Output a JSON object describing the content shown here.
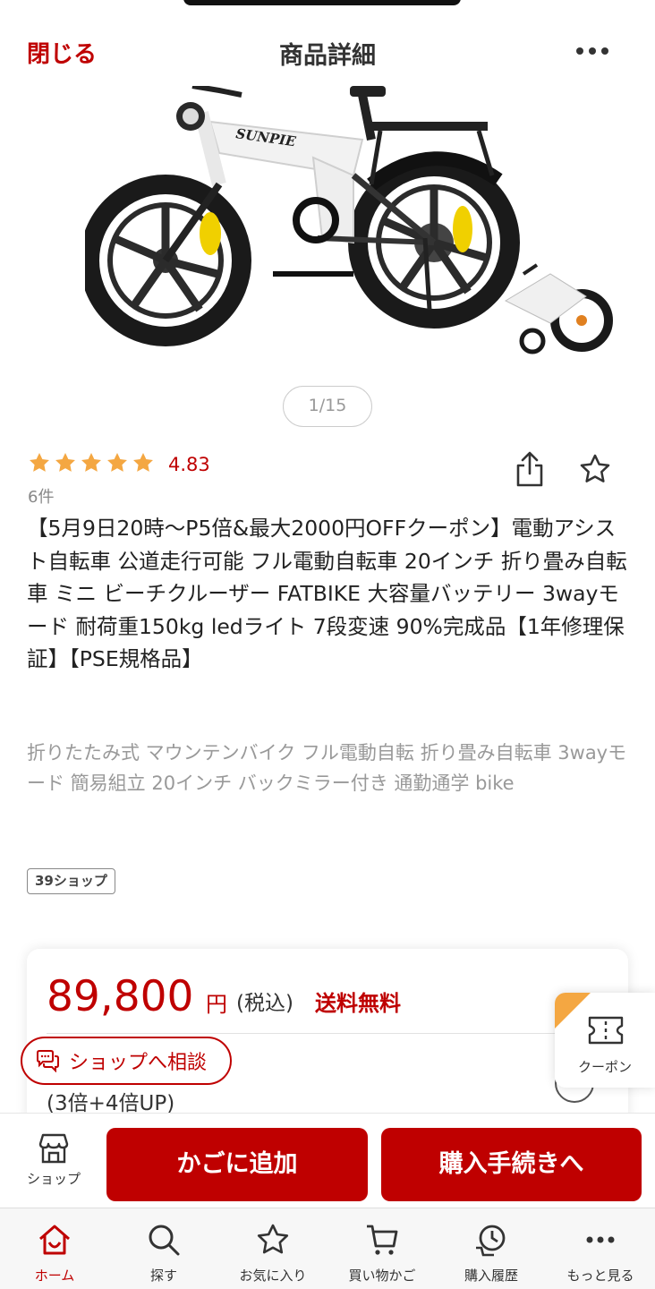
{
  "header": {
    "close_label": "閉じる",
    "title": "商品詳細"
  },
  "gallery": {
    "brand_on_frame": "SUNPIE",
    "page_indicator": "1/15"
  },
  "rating": {
    "stars": 5,
    "value": "4.83",
    "count": "6件"
  },
  "product": {
    "title": "【5月9日20時〜P5倍&最大2000円OFFクーポン】電動アシスト自転車 公道走行可能 フル電動自転車 20インチ 折り畳み自転車 ミニ ビーチクルーザー FATBIKE 大容量バッテリー 3wayモード 耐荷重150kg ledライト 7段変速 90%完成品【1年修理保証】【PSE規格品】",
    "subtitle": "折りたたみ式 マウンテンバイク フル電動自転 折り畳み自転車 3wayモード  簡易組立  20インチ バックミラー付き 通勤通学 bike",
    "shop_tag": "39ショップ"
  },
  "price_card": {
    "price": "89,800",
    "unit": "円",
    "tax": "(税込)",
    "shipping": "送料無料",
    "points": "(3倍+4倍UP)"
  },
  "floating": {
    "consult_label": "ショップへ相談",
    "coupon_label": "クーポン"
  },
  "action_bar": {
    "shop_label": "ショップ",
    "cart_label": "かごに追加",
    "buy_label": "購入手続きへ"
  },
  "bottom_nav": {
    "items": [
      {
        "label": "ホーム",
        "icon": "home-icon"
      },
      {
        "label": "探す",
        "icon": "search-icon"
      },
      {
        "label": "お気に入り",
        "icon": "star-icon"
      },
      {
        "label": "買い物かご",
        "icon": "cart-icon"
      },
      {
        "label": "購入履歴",
        "icon": "history-icon"
      },
      {
        "label": "もっと見る",
        "icon": "more-icon"
      }
    ]
  },
  "colors": {
    "brand_red": "#bf0000",
    "star_orange": "#f4a742"
  }
}
